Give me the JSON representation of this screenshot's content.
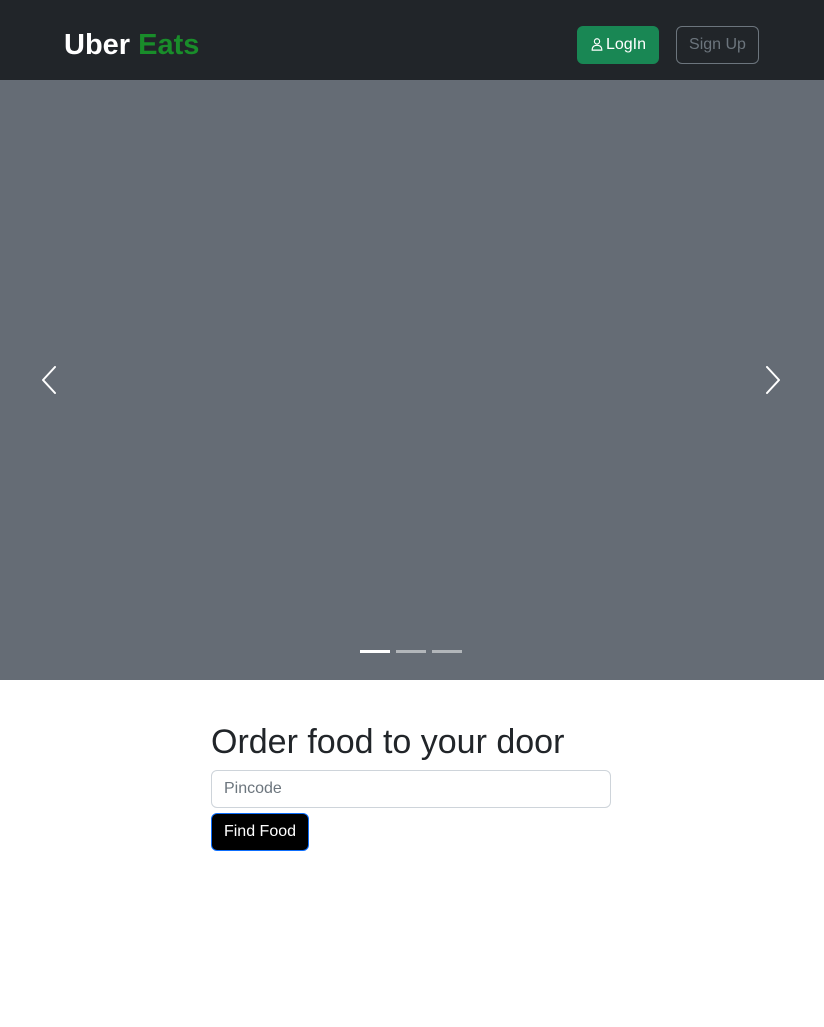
{
  "navbar": {
    "brand_part1": "Uber",
    "brand_part2": "Eats",
    "login_label": "LogIn",
    "login_icon": "person-icon",
    "signup_label": "Sign Up"
  },
  "carousel": {
    "prev_icon": "chevron-left-icon",
    "next_icon": "chevron-right-icon",
    "slide_count": 3,
    "active_slide": 1
  },
  "order": {
    "title": "Order food to your door",
    "pincode_placeholder": "Pincode",
    "pincode_value": "",
    "find_label": "Find Food"
  },
  "colors": {
    "navbar_bg": "#212529",
    "brand_accent": "#198d2a",
    "login_bg": "#198754",
    "carousel_bg": "#656c75",
    "find_button_bg": "#000000"
  }
}
